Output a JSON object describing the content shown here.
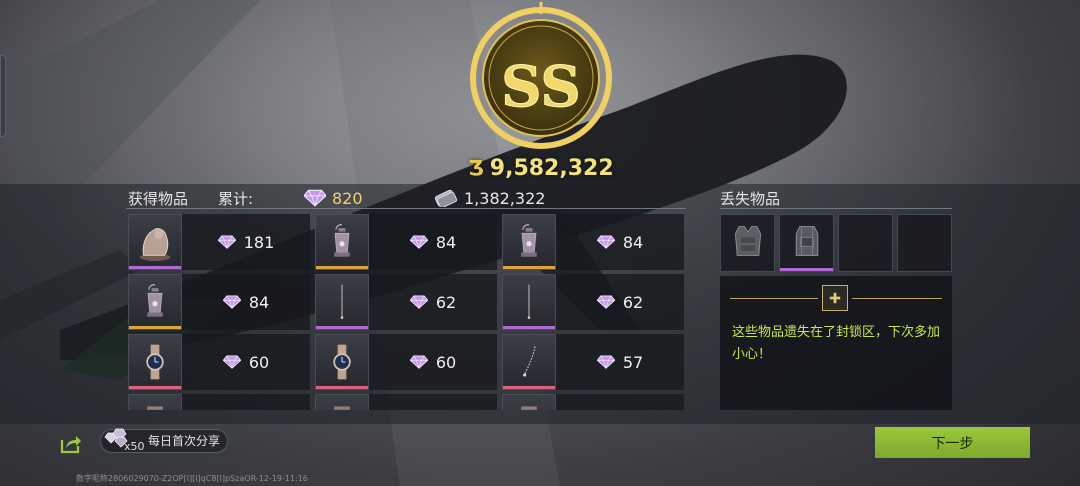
{
  "emblem": {
    "letters": "SS"
  },
  "summary": {
    "total_value": "9,582,322",
    "obtained_label": "获得物品",
    "cumulative_label": "累计:",
    "diamond_total": "820",
    "cash_total": "1,382,322",
    "lost_label": "丢失物品"
  },
  "items": [
    {
      "icon": "relic-statue-icon",
      "value": "181",
      "rarity_color": "#b06ad8"
    },
    {
      "icon": "lantern-icon",
      "value": "84",
      "rarity_color": "#e0a23a"
    },
    {
      "icon": "lantern-icon",
      "value": "84",
      "rarity_color": "#e0a23a"
    },
    {
      "icon": "lantern-icon",
      "value": "84",
      "rarity_color": "#e0a23a"
    },
    {
      "icon": "needle-icon",
      "value": "62",
      "rarity_color": "#b06ad8"
    },
    {
      "icon": "needle-icon",
      "value": "62",
      "rarity_color": "#b06ad8"
    },
    {
      "icon": "wristwatch-icon",
      "value": "60",
      "rarity_color": "#d9637a"
    },
    {
      "icon": "wristwatch-icon",
      "value": "60",
      "rarity_color": "#d9637a"
    },
    {
      "icon": "chain-icon",
      "value": "57",
      "rarity_color": "#d9637a"
    },
    {
      "icon": "item-partial-icon",
      "value": "",
      "rarity_color": "#d9637a"
    },
    {
      "icon": "item-partial-icon",
      "value": "",
      "rarity_color": "#d9637a"
    },
    {
      "icon": "item-partial-icon",
      "value": "",
      "rarity_color": "#d9637a"
    }
  ],
  "lost_items": [
    {
      "icon": "body-armor-icon",
      "rarity_color": ""
    },
    {
      "icon": "backpack-icon",
      "rarity_color": "#b06ad8"
    },
    {
      "icon": "empty-slot",
      "rarity_color": ""
    },
    {
      "icon": "empty-slot",
      "rarity_color": ""
    }
  ],
  "notice": {
    "text": "这些物品遗失在了封锁区，下次多加小心！"
  },
  "share": {
    "multiplier": "x50",
    "label": "每日首次分享"
  },
  "next_button": "下一步",
  "watermark": "数字昵称2806029070-Z2OP[I][I]qC8[I]pSzaOR-12-19-11:16",
  "colors": {
    "gold": "#f5e27a",
    "accent_green": "#8fbc34",
    "notice_text": "#c9e84d"
  }
}
